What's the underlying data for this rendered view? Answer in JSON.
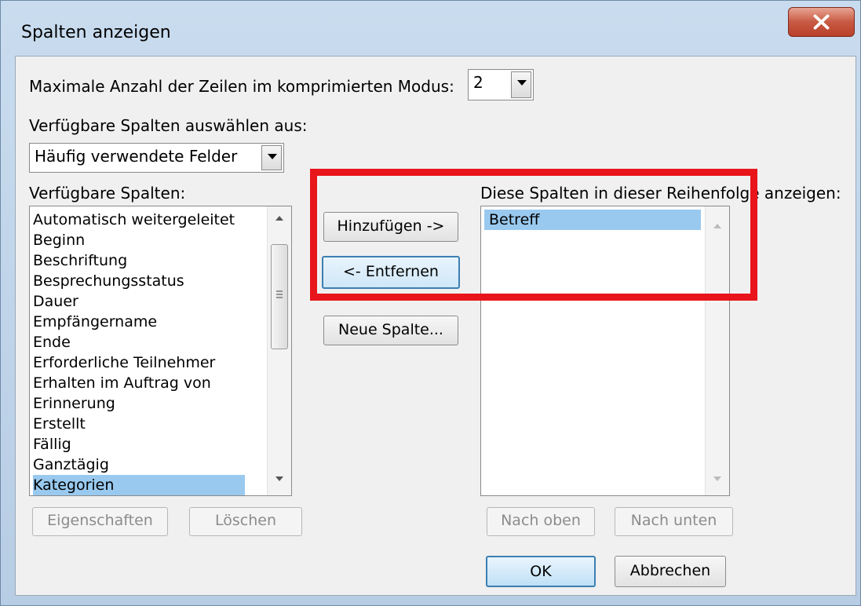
{
  "window": {
    "title": "Spalten anzeigen"
  },
  "max_rows": {
    "label": "Maximale Anzahl der Zeilen im komprimierten Modus:",
    "value": "2"
  },
  "source": {
    "label": "Verfügbare Spalten auswählen aus:",
    "value": "Häufig verwendete Felder"
  },
  "available": {
    "label": "Verfügbare Spalten:",
    "items": [
      "Automatisch weitergeleitet",
      "Beginn",
      "Beschriftung",
      "Besprechungsstatus",
      "Dauer",
      "Empfängername",
      "Ende",
      "Erforderliche Teilnehmer",
      "Erhalten im Auftrag von",
      "Erinnerung",
      "Erstellt",
      "Fällig",
      "Ganztägig",
      "Kategorien"
    ],
    "selected_index": 13
  },
  "shown": {
    "label": "Diese Spalten in dieser Reihenfolge anzeigen:",
    "items": [
      "Betreff"
    ]
  },
  "buttons": {
    "add": "Hinzufügen ->",
    "remove": "<- Entfernen",
    "new_column": "Neue Spalte...",
    "properties": "Eigenschaften",
    "delete": "Löschen",
    "move_up": "Nach oben",
    "move_down": "Nach unten",
    "ok": "OK",
    "cancel": "Abbrechen"
  },
  "colors": {
    "highlight": "#e8151b",
    "selection": "#99c9ef"
  }
}
